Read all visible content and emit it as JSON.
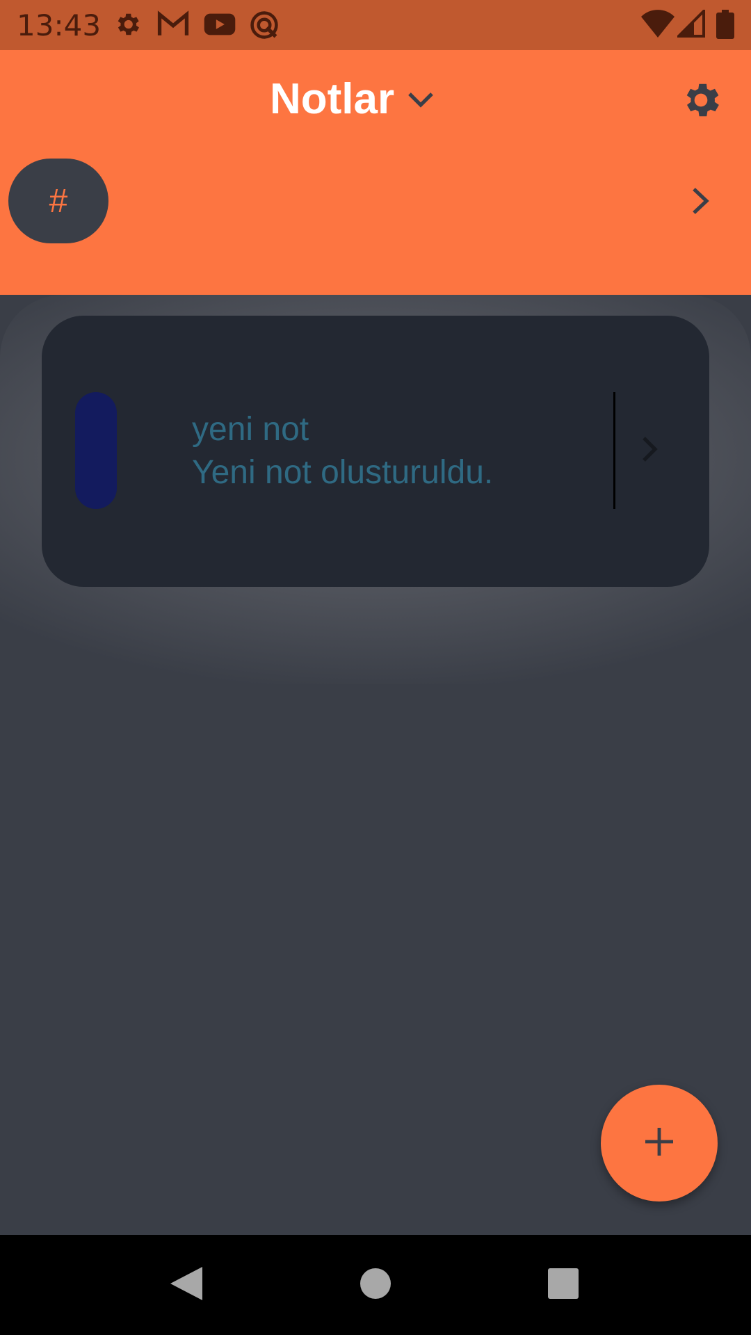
{
  "status_bar": {
    "time": "13:43",
    "icons": [
      "settings-icon",
      "gmail-icon",
      "youtube-icon",
      "quick-share-icon"
    ],
    "right_icons": [
      "wifi-icon",
      "signal-icon",
      "battery-icon"
    ]
  },
  "app_bar": {
    "title": "Notlar",
    "tag_button_label": "#",
    "colors": {
      "accent": "#fd7541",
      "status": "#c0592f"
    }
  },
  "notes": [
    {
      "title": "yeni not",
      "body": "Yeni not olusturuldu.",
      "color": "#131b5e"
    }
  ],
  "theme": {
    "background": "#3a3e47",
    "card": "#232832",
    "note_text": "#2f6a83"
  }
}
